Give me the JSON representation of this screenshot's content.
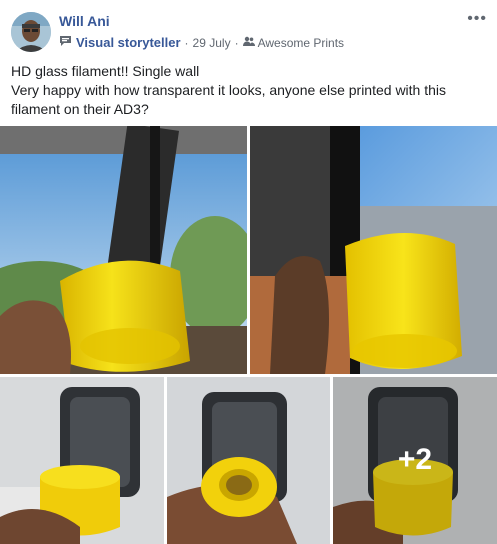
{
  "post": {
    "author": "Will Ani",
    "badge": "Visual storyteller",
    "date": "29 July",
    "group": "Awesome Prints",
    "separator": "·",
    "more_menu": "•••",
    "text_line1": "HD glass filament!! Single wall",
    "text_line2": "Very happy with how transparent it looks, anyone else printed with this",
    "text_line3": "filament on their AD3?"
  },
  "photos": {
    "extra_count": "+2"
  },
  "icons": {
    "badge": "speech-bubble-icon",
    "audience": "group-icon",
    "more": "more-options-icon"
  },
  "colors": {
    "link": "#385898",
    "meta": "#606770",
    "filament": "#f2d40c"
  }
}
